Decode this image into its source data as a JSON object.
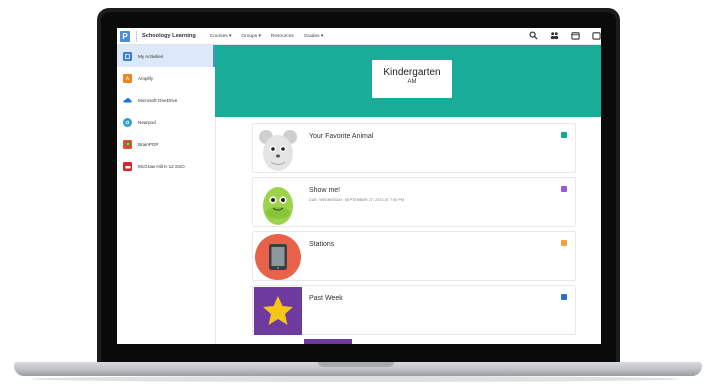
{
  "topnav": {
    "logo_letter": "P",
    "brand": "Schoology Learning",
    "items": [
      "Courses ▾",
      "Groups ▾",
      "Resources",
      "Grades ▾"
    ]
  },
  "sidebar": {
    "items": [
      {
        "label": "My Activities",
        "icon": "activities-icon",
        "color": "#3a7bd5",
        "active": true
      },
      {
        "label": "Amplify",
        "icon": "amplify-icon",
        "color": "#f0831e"
      },
      {
        "label": "Microsoft OneDrive",
        "icon": "onedrive-icon",
        "color": "#1a73d8"
      },
      {
        "label": "Nearpod",
        "icon": "nearpod-icon",
        "color": "#2f9bd6"
      },
      {
        "label": "BrainPOP",
        "icon": "brainpop-icon",
        "color": "#e94e2c"
      },
      {
        "label": "McGraw Hill K-12 SSO",
        "icon": "mcgraw-hill-icon",
        "color": "#d8262e"
      }
    ]
  },
  "banner": {
    "color": "#19ad99",
    "course_title": "Kindergarten",
    "course_subtitle": "AM"
  },
  "materials": [
    {
      "title": "Your Favorite Animal",
      "due": "",
      "thumb": "mouse-egg-icon",
      "type_color": "#1aa896"
    },
    {
      "title": "Show me!",
      "due": "DUE: WEDNESDAY, SEPTEMBER 27, 2023 AT 7:59 PM",
      "thumb": "green-egg-icon",
      "type_color": "#9b59d6"
    },
    {
      "title": "Stations",
      "due": "",
      "thumb": "tablet-icon",
      "type_color": "#f5a03a"
    },
    {
      "title": "Past Week",
      "due": "",
      "thumb": "star-icon",
      "type_color": "#2b6fd6"
    }
  ]
}
